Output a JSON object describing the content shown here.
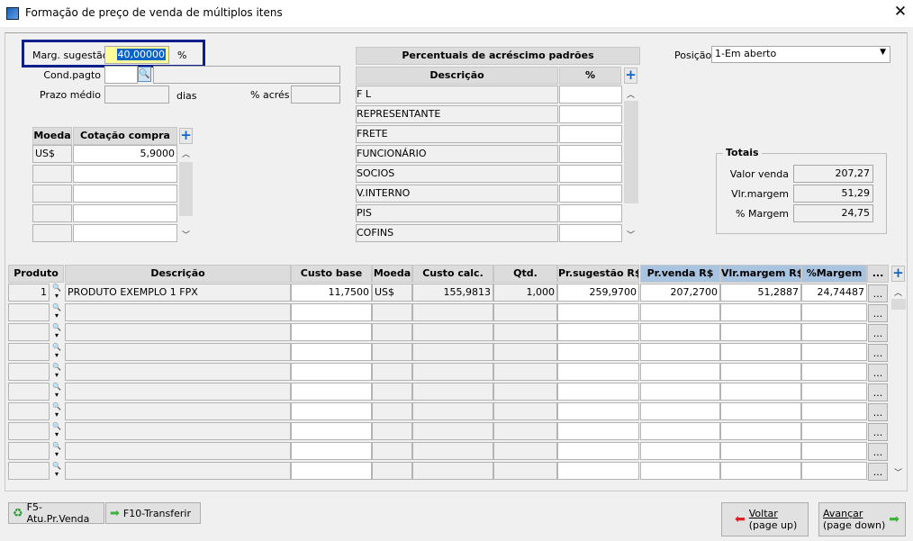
{
  "window": {
    "title": "Formação de preço de venda de múltiplos itens",
    "close_icon": "close-icon"
  },
  "form": {
    "marg_sugestao_label": "Marg. sugestão",
    "marg_sugestao_value": "40,00000",
    "marg_unit": "%",
    "cond_pagto_label": "Cond.pagto",
    "cond_pagto_value": "",
    "cond_pagto_desc": "",
    "prazo_medio_label": "Prazo médio",
    "prazo_medio_value": "",
    "dias_label": "dias",
    "acres_label": "% acrés",
    "acres_value": "",
    "posicao_label": "Posição",
    "posicao_value": "1-Em aberto"
  },
  "moeda_grid": {
    "headers": [
      "Moeda",
      "Cotação compra"
    ],
    "rows": [
      [
        "US$",
        "5,9000"
      ],
      [
        "",
        ""
      ],
      [
        "",
        ""
      ],
      [
        "",
        ""
      ],
      [
        "",
        ""
      ]
    ]
  },
  "percentuais": {
    "title": "Percentuais de acréscimo padrões",
    "headers": [
      "Descrição",
      "%"
    ],
    "rows": [
      [
        "F L",
        ""
      ],
      [
        "REPRESENTANTE",
        ""
      ],
      [
        "FRETE",
        ""
      ],
      [
        "FUNCIONÁRIO",
        ""
      ],
      [
        "SOCIOS",
        ""
      ],
      [
        "V.INTERNO",
        ""
      ],
      [
        "PIS",
        ""
      ],
      [
        "COFINS",
        ""
      ]
    ]
  },
  "totais": {
    "title": "Totais",
    "rows": [
      {
        "label": "Valor venda",
        "value": "207,27"
      },
      {
        "label": "Vlr.margem",
        "value": "51,29"
      },
      {
        "label": "% Margem",
        "value": "24,75"
      }
    ]
  },
  "grid": {
    "headers": [
      "Produto",
      "Descrição",
      "Custo base",
      "Moeda",
      "Custo calc.",
      "Qtd.",
      "Pr.sugestão R$",
      "Pr.venda R$",
      "Vlr.margem R$",
      "%Margem",
      "..."
    ],
    "rows": [
      [
        "1",
        "PRODUTO EXEMPLO 1 FPX",
        "11,7500",
        "US$",
        "155,9813",
        "1,000",
        "259,9700",
        "207,2700",
        "51,2887",
        "24,74487"
      ],
      [
        "",
        "",
        "",
        "",
        "",
        "",
        "",
        "",
        "",
        ""
      ],
      [
        "",
        "",
        "",
        "",
        "",
        "",
        "",
        "",
        "",
        ""
      ],
      [
        "",
        "",
        "",
        "",
        "",
        "",
        "",
        "",
        "",
        ""
      ],
      [
        "",
        "",
        "",
        "",
        "",
        "",
        "",
        "",
        "",
        ""
      ],
      [
        "",
        "",
        "",
        "",
        "",
        "",
        "",
        "",
        "",
        ""
      ],
      [
        "",
        "",
        "",
        "",
        "",
        "",
        "",
        "",
        "",
        ""
      ],
      [
        "",
        "",
        "",
        "",
        "",
        "",
        "",
        "",
        "",
        ""
      ],
      [
        "",
        "",
        "",
        "",
        "",
        "",
        "",
        "",
        "",
        ""
      ],
      [
        "",
        "",
        "",
        "",
        "",
        "",
        "",
        "",
        "",
        ""
      ]
    ],
    "row_button": "..."
  },
  "buttons": {
    "f5": "F5-Atu.Pr.Venda",
    "f10": "F10-Transferir",
    "voltar": "Voltar",
    "voltar_sub": "(page up)",
    "avancar": "Avançar",
    "avancar_sub": "(page down)"
  },
  "colors": {
    "highlight_border": "#0c1e8c",
    "input_focus": "#ffff99",
    "blue_header": "#a9c4e0"
  }
}
